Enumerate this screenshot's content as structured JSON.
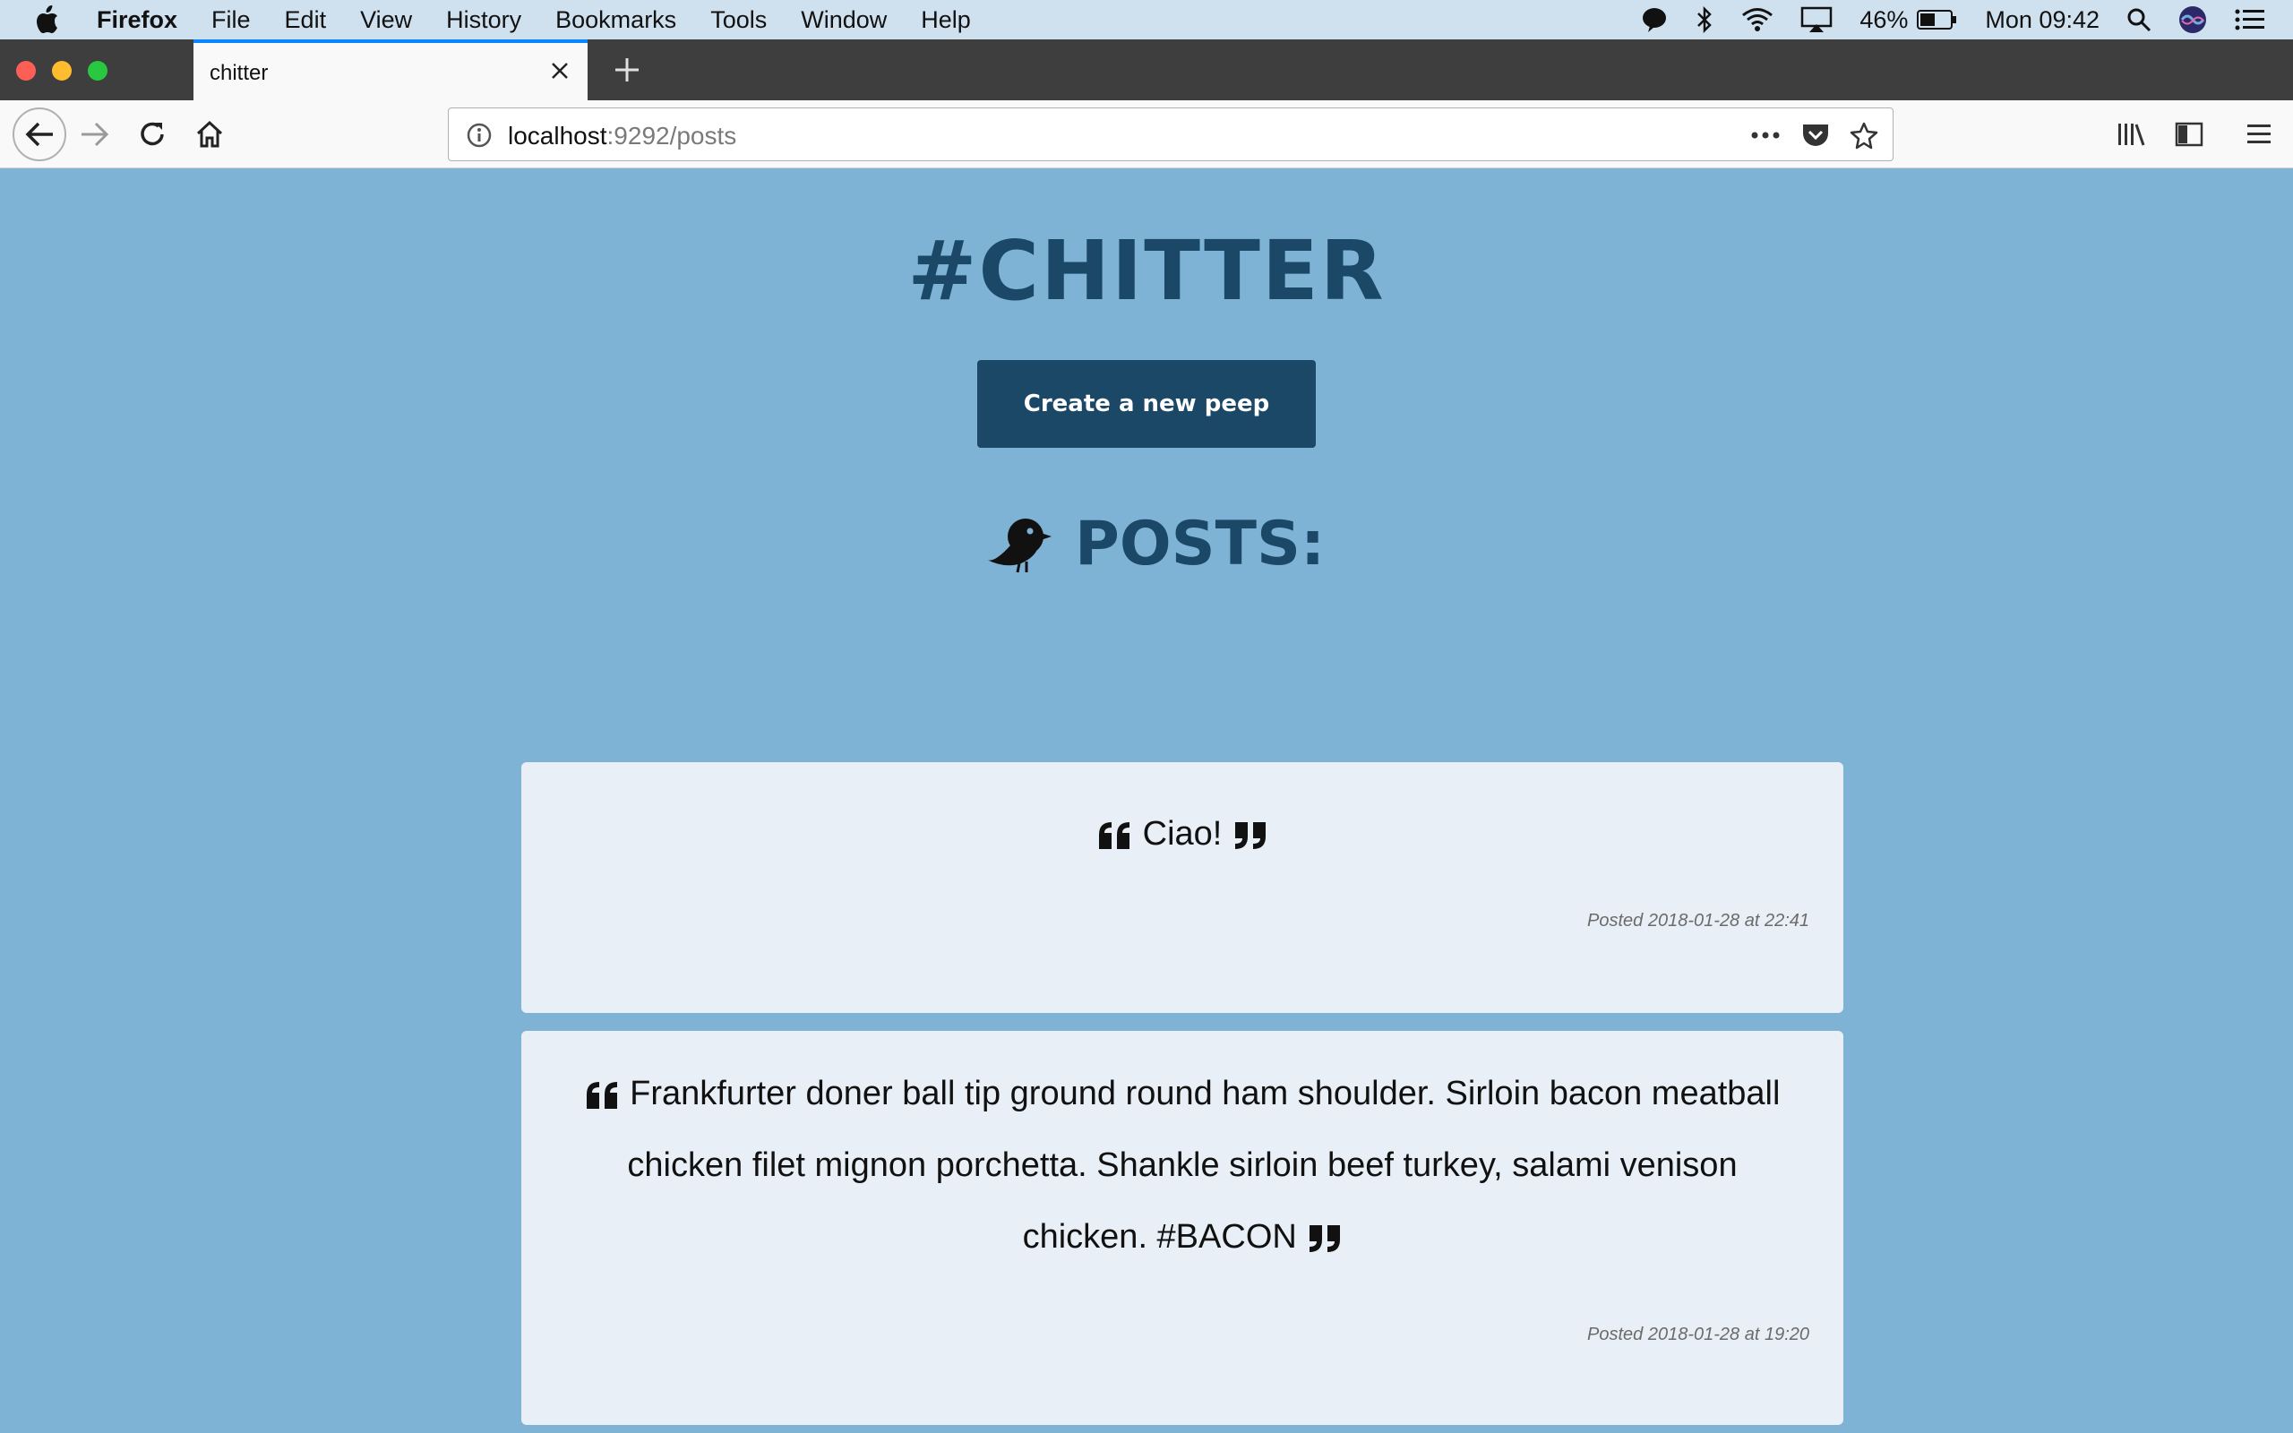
{
  "menubar": {
    "app_name": "Firefox",
    "items": [
      "File",
      "Edit",
      "View",
      "History",
      "Bookmarks",
      "Tools",
      "Window",
      "Help"
    ],
    "battery": "46%",
    "clock": "Mon 09:42"
  },
  "tab": {
    "title": "chitter"
  },
  "urlbar": {
    "host": "localhost",
    "path": ":9292/posts"
  },
  "page": {
    "site_title": "#CHITTER",
    "new_peep_label": "Create a new peep",
    "posts_heading": "POSTS:",
    "posts": [
      {
        "message": "Ciao!",
        "posted": "Posted 2018-01-28 at 22:41"
      },
      {
        "message": "Frankfurter doner ball tip ground round ham shoulder. Sirloin bacon meatball chicken filet mignon porchetta. Shankle sirloin beef turkey, salami venison chicken. #BACON",
        "posted": "Posted 2018-01-28 at 19:20"
      }
    ]
  },
  "colors": {
    "page_bg": "#7fb3d6",
    "brand_dark": "#1a4866",
    "card_bg": "#e9eff6"
  }
}
